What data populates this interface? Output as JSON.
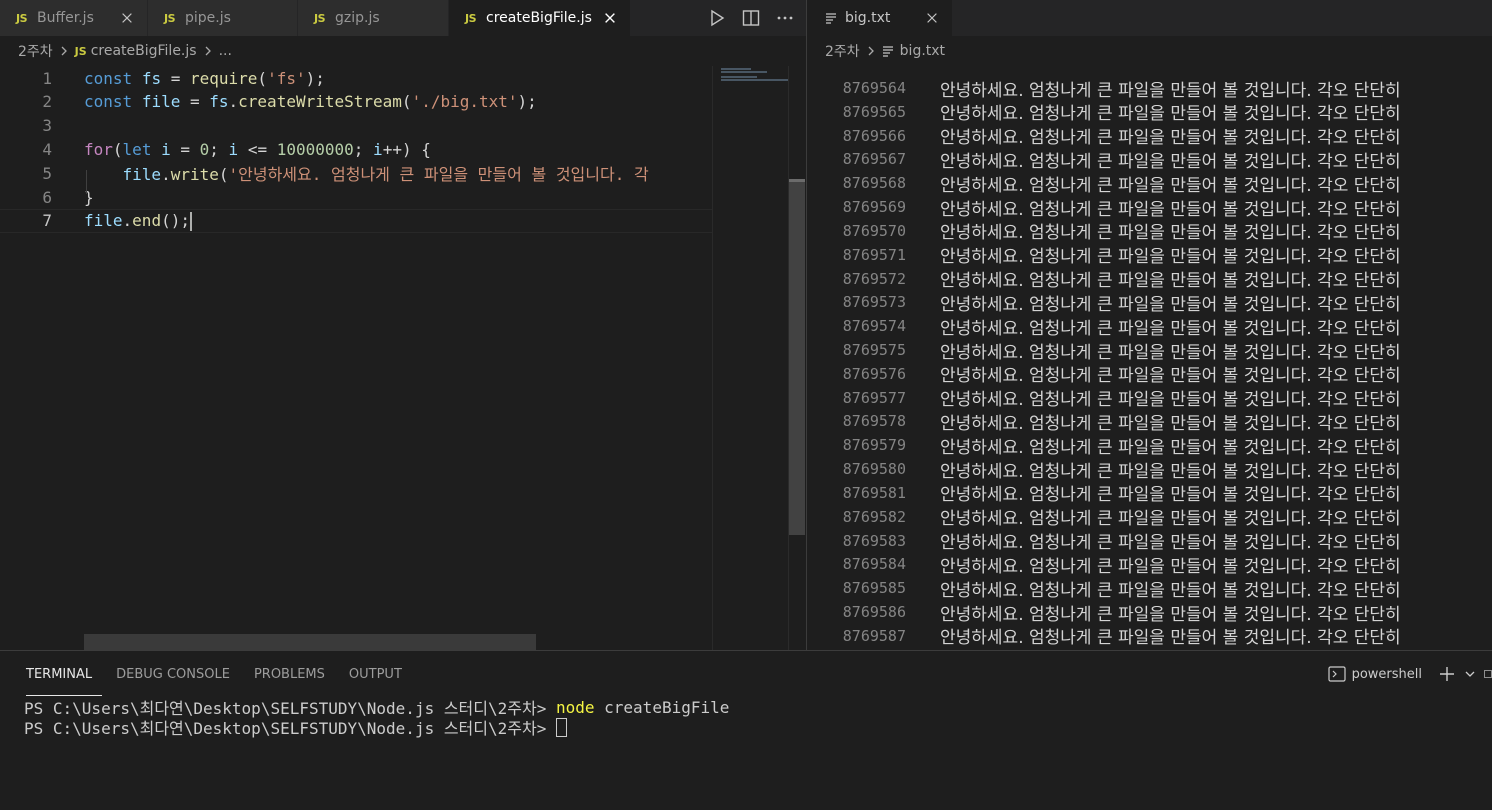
{
  "left_editor": {
    "tabs": [
      {
        "badge": "JS",
        "label": "Buffer.js",
        "active": false
      },
      {
        "badge": "JS",
        "label": "pipe.js",
        "active": false
      },
      {
        "badge": "JS",
        "label": "gzip.js",
        "active": false
      },
      {
        "badge": "JS",
        "label": "createBigFile.js",
        "active": true
      }
    ],
    "breadcrumb": {
      "folder": "2주차",
      "badge": "JS",
      "file": "createBigFile.js",
      "more": "..."
    },
    "code_lines": [
      {
        "n": "1",
        "tokens": [
          [
            "kw",
            "const"
          ],
          [
            "p",
            " "
          ],
          [
            "var",
            "fs"
          ],
          [
            "p",
            " = "
          ],
          [
            "fn",
            "require"
          ],
          [
            "p",
            "("
          ],
          [
            "str",
            "'fs'"
          ],
          [
            "p",
            ");"
          ]
        ]
      },
      {
        "n": "2",
        "tokens": [
          [
            "kw",
            "const"
          ],
          [
            "p",
            " "
          ],
          [
            "var",
            "file"
          ],
          [
            "p",
            " = "
          ],
          [
            "var",
            "fs"
          ],
          [
            "p",
            "."
          ],
          [
            "fn",
            "createWriteStream"
          ],
          [
            "p",
            "("
          ],
          [
            "str",
            "'./big.txt'"
          ],
          [
            "p",
            ");"
          ]
        ]
      },
      {
        "n": "3",
        "tokens": []
      },
      {
        "n": "4",
        "tokens": [
          [
            "ctl",
            "for"
          ],
          [
            "p",
            "("
          ],
          [
            "kw",
            "let"
          ],
          [
            "p",
            " "
          ],
          [
            "var",
            "i"
          ],
          [
            "p",
            " = "
          ],
          [
            "num",
            "0"
          ],
          [
            "p",
            "; "
          ],
          [
            "var",
            "i"
          ],
          [
            "p",
            " <= "
          ],
          [
            "num",
            "10000000"
          ],
          [
            "p",
            "; "
          ],
          [
            "var",
            "i"
          ],
          [
            "p",
            "++) {"
          ]
        ]
      },
      {
        "n": "5",
        "tokens": [
          [
            "p",
            "    "
          ],
          [
            "var",
            "file"
          ],
          [
            "p",
            "."
          ],
          [
            "fn",
            "write"
          ],
          [
            "p",
            "("
          ],
          [
            "str",
            "'안녕하세요. 엄청나게 큰 파일을 만들어 볼 것입니다. 각"
          ]
        ]
      },
      {
        "n": "6",
        "tokens": [
          [
            "p",
            "}"
          ]
        ]
      },
      {
        "n": "7",
        "tokens": [
          [
            "var",
            "file"
          ],
          [
            "p",
            "."
          ],
          [
            "fn",
            "end"
          ],
          [
            "p",
            "();"
          ]
        ]
      }
    ]
  },
  "right_editor": {
    "tab": {
      "label": "big.txt"
    },
    "breadcrumb": {
      "folder": "2주차",
      "file": "big.txt"
    },
    "line_text": "안녕하세요. 엄청나게 큰 파일을 만들어 볼 것입니다. 각오 단단히",
    "line_numbers": [
      "8769564",
      "8769565",
      "8769566",
      "8769567",
      "8769568",
      "8769569",
      "8769570",
      "8769571",
      "8769572",
      "8769573",
      "8769574",
      "8769575",
      "8769576",
      "8769577",
      "8769578",
      "8769579",
      "8769580",
      "8769581",
      "8769582",
      "8769583",
      "8769584",
      "8769585",
      "8769586",
      "8769587"
    ]
  },
  "panel": {
    "tabs": [
      "TERMINAL",
      "DEBUG CONSOLE",
      "PROBLEMS",
      "OUTPUT"
    ],
    "shell": "powershell",
    "lines": [
      {
        "prompt": "PS C:\\Users\\최다연\\Desktop\\SELFSTUDY\\Node.js 스터디\\2주차> ",
        "cmd": "node",
        "args": " createBigFile"
      },
      {
        "prompt": "PS C:\\Users\\최다연\\Desktop\\SELFSTUDY\\Node.js 스터디\\2주차> ",
        "cmd": "",
        "args": ""
      }
    ]
  },
  "colors": {
    "accent_js": "#cbcb41",
    "command": "#f5f543"
  }
}
